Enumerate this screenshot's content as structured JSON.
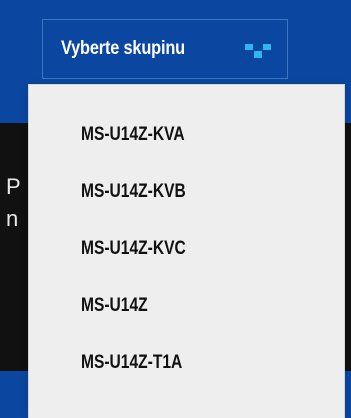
{
  "background": {
    "partial_text_line1": "P",
    "partial_text_line2": "n"
  },
  "group_select": {
    "label": "Vyberte skupinu",
    "icon": "chevron-down-icon"
  },
  "dropdown": {
    "items": [
      {
        "label": "MS-U14Z-KVA"
      },
      {
        "label": "MS-U14Z-KVB"
      },
      {
        "label": "MS-U14Z-KVC"
      },
      {
        "label": "MS-U14Z"
      },
      {
        "label": "MS-U14Z-T1A"
      }
    ]
  },
  "colors": {
    "brand_blue": "#0b47a0",
    "icon_cyan": "#2fb6f0",
    "menu_bg": "#eeeeee",
    "dark_panel": "#111111"
  }
}
